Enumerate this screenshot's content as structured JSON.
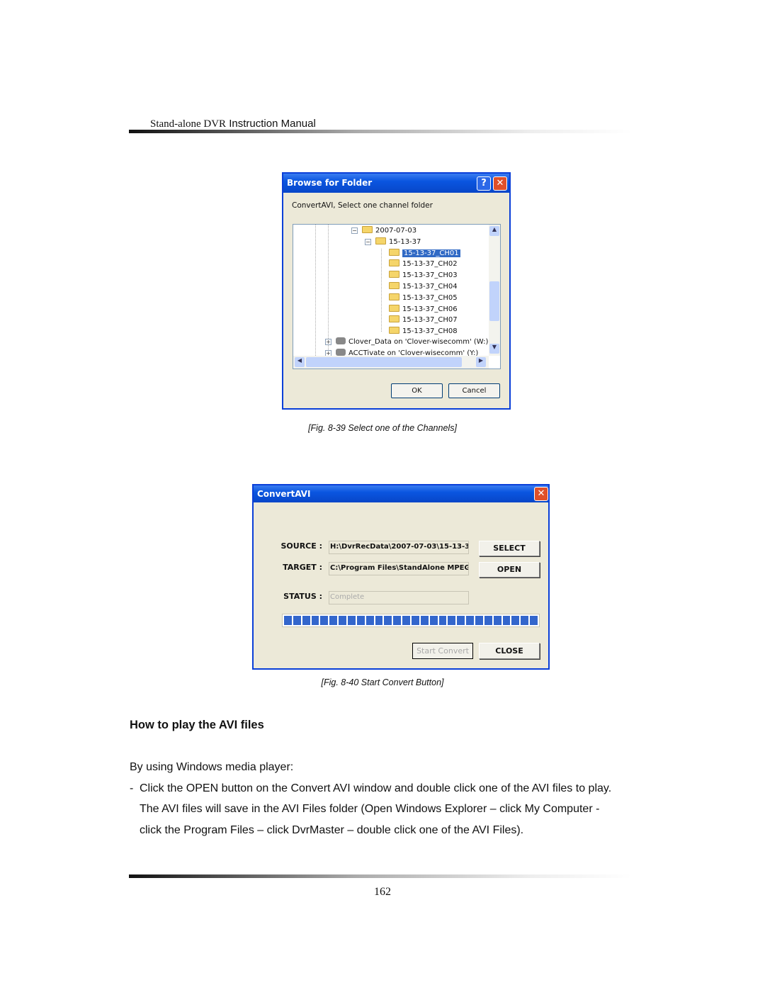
{
  "header": {
    "title_serif": "Stand-alone DVR",
    "title_sans": "Instruction Manual"
  },
  "fig1": {
    "window_title": "Browse for Folder",
    "prompt": "ConvertAVI, Select one channel folder",
    "tree": [
      {
        "label": "2007-07-03",
        "expander": "−",
        "level": 0
      },
      {
        "label": "15-13-37",
        "expander": "−",
        "level": 1
      },
      {
        "label": "15-13-37_CH01",
        "selected": true,
        "level": 2
      },
      {
        "label": "15-13-37_CH02",
        "level": 2
      },
      {
        "label": "15-13-37_CH03",
        "level": 2
      },
      {
        "label": "15-13-37_CH04",
        "level": 2
      },
      {
        "label": "15-13-37_CH05",
        "level": 2
      },
      {
        "label": "15-13-37_CH06",
        "level": 2
      },
      {
        "label": "15-13-37_CH07",
        "level": 2
      },
      {
        "label": "15-13-37_CH08",
        "level": 2
      }
    ],
    "drives": [
      {
        "label": "Clover_Data on 'Clover-wisecomm' (W:)"
      },
      {
        "label": "ACCTivate on 'Clover-wisecomm' (Y:)"
      }
    ],
    "ok": "OK",
    "cancel": "Cancel",
    "help": "?",
    "close": "✕",
    "caption": "[Fig. 8-39 Select one of the Channels]"
  },
  "fig2": {
    "window_title": "ConvertAVI",
    "close": "✕",
    "source_label": "SOURCE :",
    "source_value": "H:\\DvrRecData\\2007-07-03\\15-13-37",
    "target_label": "TARGET :",
    "target_value": "C:\\Program Files\\StandAlone MPEG",
    "status_label": "STATUS :",
    "status_value": "Complete",
    "progress_percent": 100,
    "select": "SELECT",
    "open": "OPEN",
    "start_convert": "Start Convert",
    "close_btn": "CLOSE",
    "caption": "[Fig. 8-40 Start Convert Button]"
  },
  "section": {
    "heading": "How to play the AVI files",
    "intro": "By using Windows media player:",
    "bullet": "-",
    "lines": [
      "Click the OPEN button on the Convert AVI window and double click one of the AVI files to play.",
      "The AVI files will save in the AVI Files folder (Open Windows Explorer – click My Computer -",
      "click the Program Files – click DvrMaster – double click one of the AVI Files)."
    ]
  },
  "page_number": "162",
  "colors": {
    "title_bar": "#0a55e0",
    "selection": "#316ac5",
    "progress": "#3366cc",
    "dialog_bg": "#ece9d8"
  }
}
